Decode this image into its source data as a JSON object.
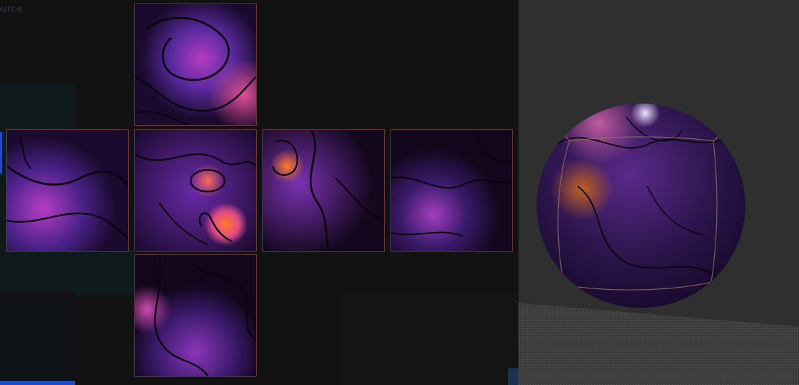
{
  "source_panel": {
    "label": "ource"
  },
  "cubemap": {
    "faces": [
      "top",
      "left",
      "front",
      "right",
      "back",
      "bottom"
    ],
    "palette": {
      "deep": "#1a0a2e",
      "violet": "#5a2a9e",
      "magenta": "#b63cc4",
      "orange": "#ff7a2a",
      "line": "#0b0410"
    }
  },
  "viewport": {
    "background": "#2f2f2f",
    "floor": "#3b3b3b",
    "object": "sphere"
  }
}
